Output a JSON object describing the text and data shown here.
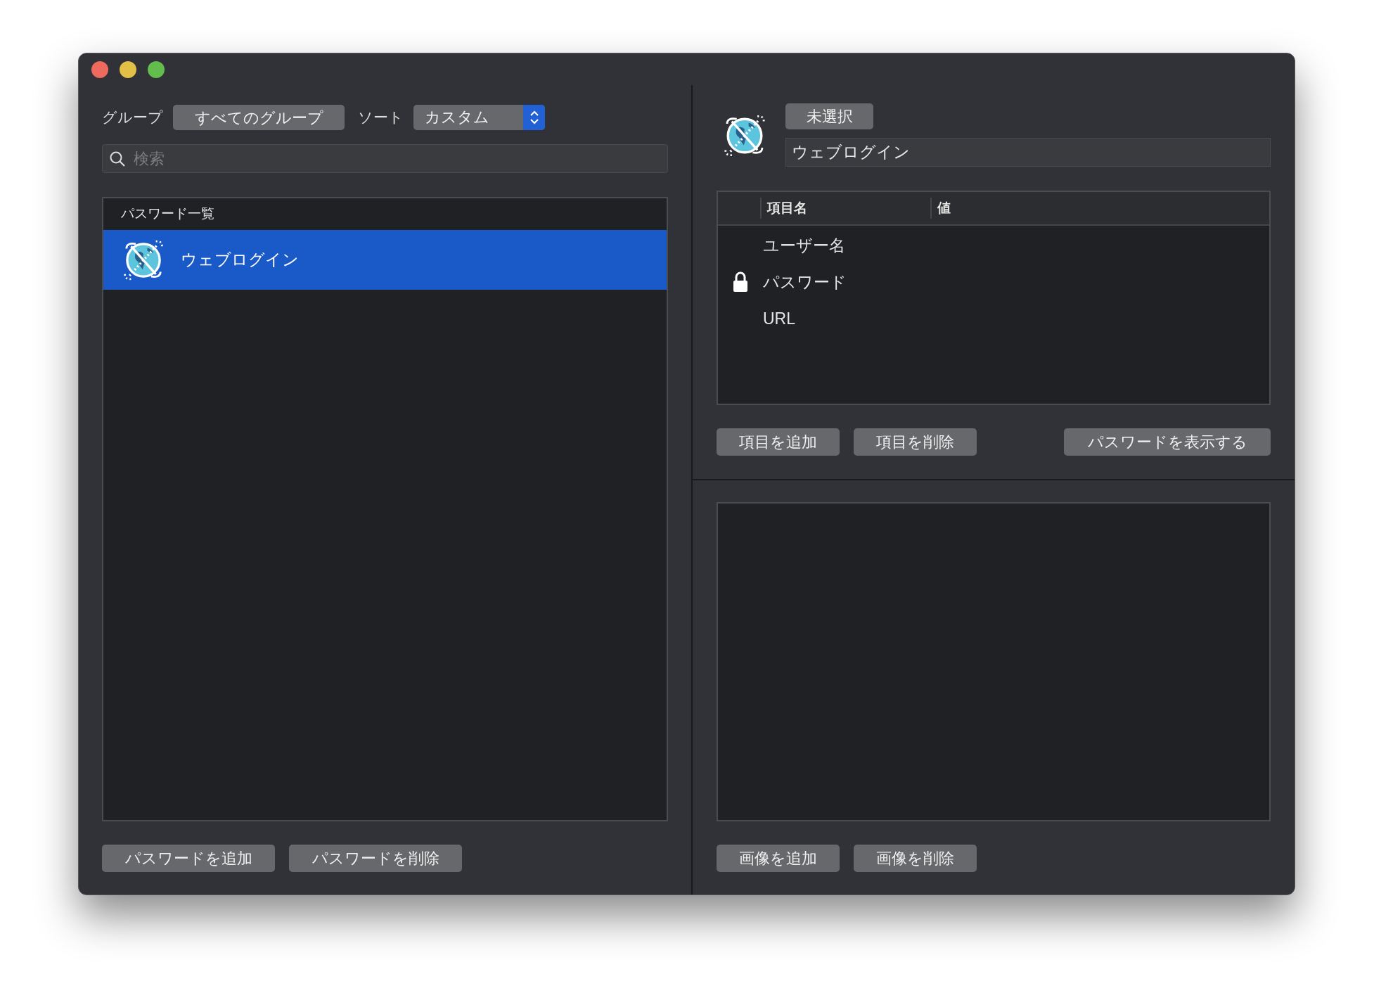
{
  "toolbar": {
    "group_label": "グループ",
    "group_button": "すべてのグループ",
    "sort_label": "ソート",
    "sort_value": "カスタム"
  },
  "search": {
    "placeholder": "検索"
  },
  "password_list": {
    "header": "パスワード一覧",
    "items": [
      {
        "name": "ウェブログイン",
        "selected": true
      }
    ]
  },
  "list_buttons": [
    "パスワードを追加",
    "パスワードを削除"
  ],
  "detail": {
    "state_button": "未選択",
    "name_value": "ウェブログイン"
  },
  "fields_table": {
    "columns": [
      "項目名",
      "値"
    ],
    "rows": [
      {
        "name": "ユーザー名",
        "locked": false
      },
      {
        "name": "パスワード",
        "locked": true
      },
      {
        "name": "URL",
        "locked": false
      }
    ]
  },
  "field_buttons": [
    "項目を追加",
    "項目を削除"
  ],
  "reveal_button": "パスワードを表示する",
  "image_buttons": [
    "画像を追加",
    "画像を削除"
  ]
}
